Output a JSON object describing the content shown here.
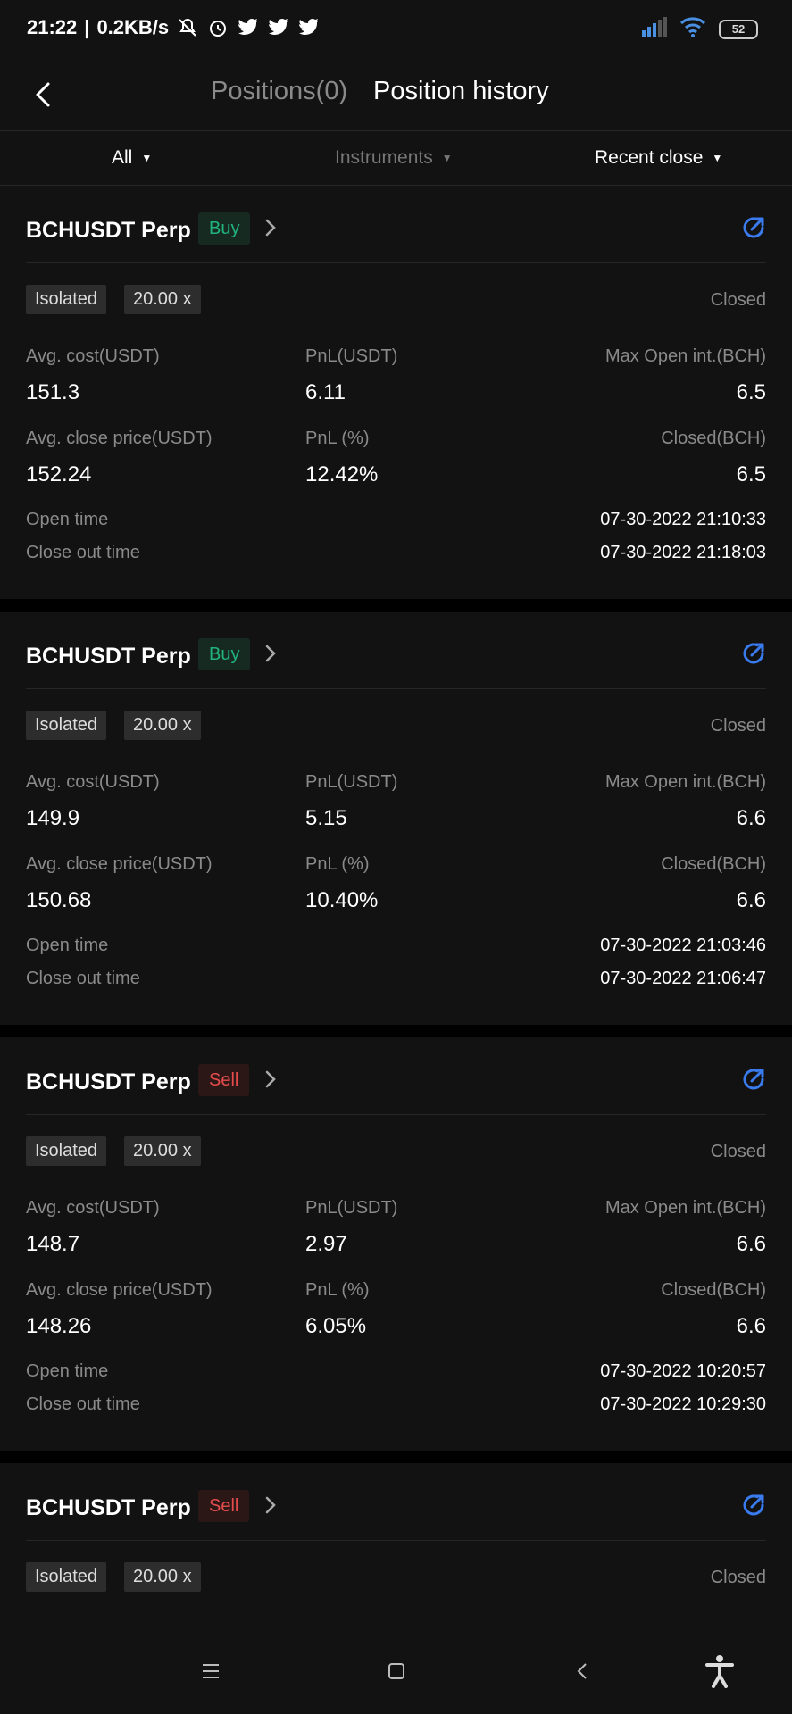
{
  "status_bar": {
    "time": "21:22",
    "speed": "0.2KB/s",
    "battery": "52",
    "icons": [
      "mute-icon",
      "alarm-icon",
      "twitter-icon",
      "twitter-icon",
      "twitter-icon",
      "signal-icon",
      "wifi-icon",
      "battery-icon"
    ]
  },
  "nav": {
    "tab_positions": "Positions(0)",
    "tab_history": "Position history"
  },
  "filters": {
    "all": "All",
    "instruments": "Instruments",
    "recent": "Recent close"
  },
  "labels": {
    "isolated": "Isolated",
    "leverage": "20.00 x",
    "closed": "Closed",
    "avg_cost": "Avg. cost(USDT)",
    "pnl": "PnL(USDT)",
    "max_open": "Max Open int.(BCH)",
    "avg_close": "Avg. close price(USDT)",
    "pnl_pct": "PnL (%)",
    "closed_qty": "Closed(BCH)",
    "open_time": "Open time",
    "close_time": "Close out time"
  },
  "positions": [
    {
      "symbol": "BCHUSDT Perp",
      "side": "Buy",
      "avg_cost": "151.3",
      "pnl": "6.11",
      "max_open": "6.5",
      "avg_close": "152.24",
      "pnl_pct": "12.42%",
      "closed_qty": "6.5",
      "open_time": "07-30-2022 21:10:33",
      "close_time": "07-30-2022 21:18:03"
    },
    {
      "symbol": "BCHUSDT Perp",
      "side": "Buy",
      "avg_cost": "149.9",
      "pnl": "5.15",
      "max_open": "6.6",
      "avg_close": "150.68",
      "pnl_pct": "10.40%",
      "closed_qty": "6.6",
      "open_time": "07-30-2022 21:03:46",
      "close_time": "07-30-2022 21:06:47"
    },
    {
      "symbol": "BCHUSDT Perp",
      "side": "Sell",
      "avg_cost": "148.7",
      "pnl": "2.97",
      "max_open": "6.6",
      "avg_close": "148.26",
      "pnl_pct": "6.05%",
      "closed_qty": "6.6",
      "open_time": "07-30-2022 10:20:57",
      "close_time": "07-30-2022 10:29:30"
    },
    {
      "symbol": "BCHUSDT Perp",
      "side": "Sell"
    }
  ],
  "colors": {
    "buy": "#21b47c",
    "sell": "#e44c4c",
    "accent": "#3a7bf0"
  }
}
